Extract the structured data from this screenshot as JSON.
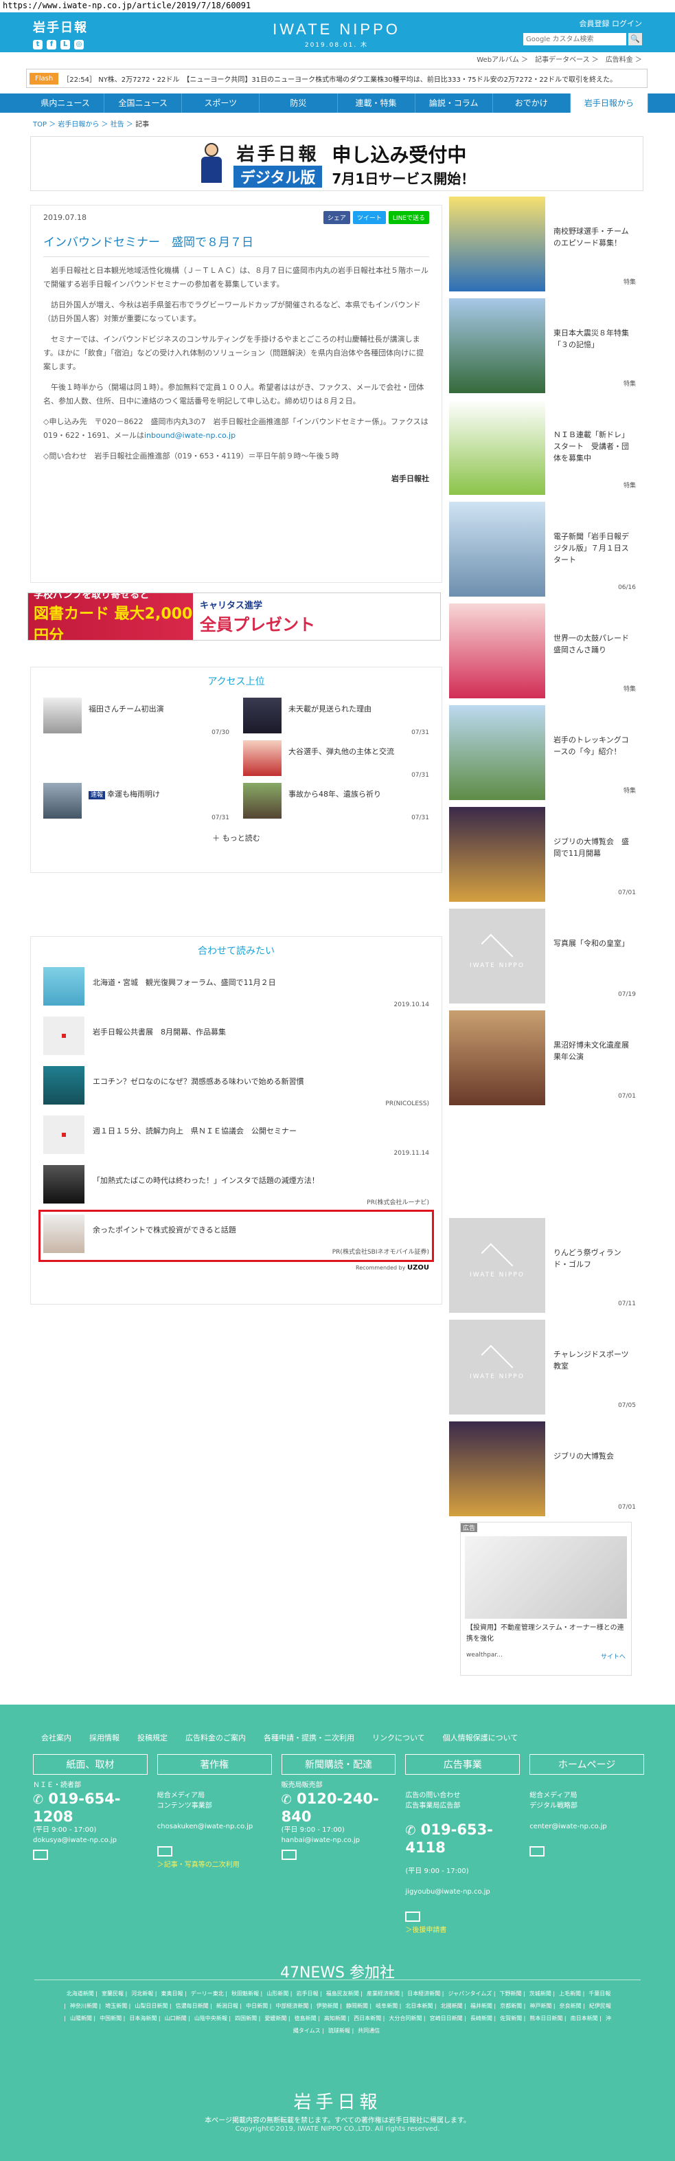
{
  "url": "https://www.iwate-np.co.jp/article/2019/7/18/60091",
  "header": {
    "logo": "岩手日報",
    "social": [
      "t",
      "f",
      "LINE",
      "ig"
    ],
    "brand": "IWATE NIPPO",
    "date": "2019.08.01. 木",
    "links": "会員登録 ログイン",
    "search_placeholder": "Google カスタム検索",
    "search_btn": "🔍"
  },
  "sublinks": [
    "Webアルバム ＞",
    "記事データベース ＞",
    "広告料金 ＞"
  ],
  "flash": {
    "label": "Flash",
    "text": "［22:54］ NY株、2万7272・22ドル　【ニューヨーク共同】31日のニューヨーク株式市場のダウ工業株30種平均は、前日比333・75ドル安の2万7272・22ドルで取引を終えた。"
  },
  "nav": [
    "県内ニュース",
    "全国ニュース",
    "スポーツ",
    "防災",
    "連載・特集",
    "論説・コラム",
    "おでかけ",
    "岩手日報から"
  ],
  "breadcrumb": [
    "TOP",
    "岩手日報から",
    "社告",
    "記事"
  ],
  "banner": {
    "logo1": "岩手日報",
    "logo2": "デジタル版",
    "copy1": "申し込み受付中",
    "copy2": "7月1日サービス開始！"
  },
  "article": {
    "date": "2019.07.18",
    "share": [
      "シェア",
      "ツイート",
      "LINEで送る"
    ],
    "title": "インバウンドセミナー　盛岡で８月７日",
    "p1": "岩手日報社と日本観光地域活性化機構（Ｊ－ＴＬＡＣ）は、８月７日に盛岡市内丸の岩手日報社本社５階ホールで開催する岩手日報インバウンドセミナーの参加者を募集しています。",
    "p2": "訪日外国人が増え、今秋は岩手県釜石市でラグビーワールドカップが開催されるなど、本県でもインバウンド（訪日外国人客）対策が重要になっています。",
    "p3": "セミナーでは、インバウンドビジネスのコンサルティングを手掛けるやまとごころの村山慶輔社長が講演します。ほかに「飲食」「宿泊」などの受け入れ体制のソリューション（問題解決）を県内自治体や各種団体向けに提案します。",
    "p4": "午後１時半から（開場は同１時）。参加無料で定員１００人。希望者ははがき、ファクス、メールで会社・団体名、参加人数、住所、日中に連絡のつく電話番号を明記して申し込む。締め切りは８月２日。",
    "apply": "◇申し込み先　〒020－8622　盛岡市内丸3の7　岩手日報社企画推進部「インバウンドセミナー係」。ファクスは019・622・1691、メールは",
    "apply_mail": "inbound@iwate-np.co.jp",
    "inquiry": "◇問い合わせ　岩手日報社企画推進部（019・653・4119）＝平日午前９時～午後５時",
    "source": "岩手日報社"
  },
  "adbar": {
    "line1": "学校パンフを取り寄せると",
    "line2": "図書カード 最大2,000円分",
    "line3": "キャリタス進学",
    "line4": "全員プレゼント"
  },
  "ranking": {
    "title": "アクセス上位",
    "items": [
      {
        "text": "福田さんチーム初出演",
        "date": "07/30"
      },
      {
        "text": "未天載が見送られた理由",
        "date": "07/31"
      },
      {
        "text": "",
        "date": ""
      },
      {
        "text": "大谷選手、弾丸他の主体と交流",
        "date": "07/31"
      },
      {
        "badge": "速報",
        "text": "幸運も梅雨明け",
        "date": "07/31"
      },
      {
        "text": "事故から48年、遺族ら祈り",
        "date": "07/31"
      }
    ],
    "more": "もっと読む"
  },
  "related": {
    "title": "合わせて読みたい",
    "items": [
      {
        "text": "北海道・宮城　観光復興フォーラム、盛岡で11月２日",
        "meta": "2019.10.14"
      },
      {
        "text": "岩手日報公共書展　8月開幕、作品募集",
        "meta": ""
      },
      {
        "text": "エコチン？ゼロなのになぜ？潤感感ある味わいで始める新習慣",
        "meta": "PR(NICOLESS)"
      },
      {
        "text": "週１日１５分、読解力向上　県ＮＩＥ協議会　公開セミナー",
        "meta": "2019.11.14"
      },
      {
        "text": "「加熱式たばこの時代は終わった！」インスタで話題の減煙方法！",
        "meta": "PR(株式会社ルーナビ)"
      },
      {
        "text": "余ったポイントで株式投資ができると話題",
        "meta": "PR(株式会社SBIネオモバイル証券)"
      }
    ],
    "recommend": "Recommended by",
    "recommend_brand": "UZOU"
  },
  "sidebar": [
    {
      "text": "南校野球選手・チームのエピソード募集！",
      "date": "特集"
    },
    {
      "text": "東日本大震災８年特集「３の記憶」",
      "date": "特集"
    },
    {
      "text": "ＮＩＢ連載「新ドレ」スタート　受講者・団体を募集中",
      "date": "特集"
    },
    {
      "text": "電子新聞「岩手日報デジタル版」７月１日スタート",
      "date": "06/16"
    },
    {
      "text": "世界一の太鼓パレード　盛岡さんさ踊り",
      "date": "特集"
    },
    {
      "text": "岩手のトレッキングコースの「今」紹介！",
      "date": "特集"
    },
    {
      "text": "ジブリの大博覧会　盛岡で11月開幕",
      "date": "07/01"
    },
    {
      "text": "写真展「令和の皇室」",
      "date": "07/19"
    },
    {
      "text": "黒沼好博未文化遺産展果年公演",
      "date": "07/01"
    },
    {
      "text": "りんどう祭ヴィランド・ゴルフ",
      "date": "07/11"
    },
    {
      "text": "チャレンジドスポーツ教室",
      "date": "07/05"
    },
    {
      "text": "ジブリの大博覧会",
      "date": "07/01"
    }
  ],
  "side_ad": {
    "pr": "広告",
    "text": "【投資用】不動産管理システム・オーナー様との連携を強化",
    "brand": "wealthpar...",
    "site": "サイトへ"
  },
  "footer": {
    "links": [
      "会社案内",
      "採用情報",
      "投稿規定",
      "広告料金のご案内",
      "各種申請・提携・二次利用",
      "リンクについて",
      "個人情報保護について"
    ],
    "cols": [
      {
        "title": "紙面、取材",
        "l1": "ＮＩＥ・読者部",
        "tel": "019-654-1208",
        "hours": "(平日 9:00 - 17:00)",
        "mail": "dokusya@iwate-np.co.jp",
        "extra": ""
      },
      {
        "title": "著作権",
        "l1": "総合メディア局\nコンテンツ事業部",
        "tel": "",
        "hours": "",
        "mail": "chosakuken@iwate-np.co.jp",
        "extra": "＞記事・写真等の二次利用"
      },
      {
        "title": "新聞購読・配達",
        "l1": "販売局販売部",
        "tel": "0120-240-840",
        "hours": "(平日 9:00 - 17:00)",
        "mail": "hanbai@iwate-np.co.jp",
        "extra": ""
      },
      {
        "title": "広告事業",
        "l1": "広告の問い合わせ\n広告事業局広告部",
        "tel": "019-653-4118",
        "hours": "(平日 9:00 - 17:00)",
        "mail": "jigyoubu@iwate-np.co.jp",
        "extra": "＞後援申請書"
      },
      {
        "title": "ホームページ",
        "l1": "総合メディア局\nデジタル戦略部",
        "tel": "",
        "hours": "",
        "mail": "center@iwate-np.co.jp",
        "extra": ""
      }
    ],
    "news47": "47NEWS 参加社",
    "papers": [
      "北海道新聞",
      "室蘭民報",
      "河北新報",
      "東奥日報",
      "デーリー東北",
      "秋田魁新報",
      "山形新聞",
      "岩手日報",
      "福島民友新聞",
      "産業経済新聞",
      "日本経済新聞",
      "ジャパンタイムズ",
      "下野新聞",
      "茨城新聞",
      "上毛新聞",
      "千葉日報",
      "神奈川新聞",
      "埼玉新聞",
      "山梨日日新聞",
      "信濃毎日新聞",
      "新潟日報",
      "中日新聞",
      "中部経済新聞",
      "伊勢新聞",
      "静岡新聞",
      "岐阜新聞",
      "北日本新聞",
      "北國新聞",
      "福井新聞",
      "京都新聞",
      "神戸新聞",
      "奈良新聞",
      "紀伊民報",
      "山陽新聞",
      "中国新聞",
      "日本海新聞",
      "山口新聞",
      "山陰中央新報",
      "四国新聞",
      "愛媛新聞",
      "徳島新聞",
      "高知新聞",
      "西日本新聞",
      "大分合同新聞",
      "宮崎日日新聞",
      "長崎新聞",
      "佐賀新聞",
      "熊本日日新聞",
      "南日本新聞",
      "沖縄タイムス",
      "琉球新報",
      "共同通信"
    ],
    "logo": "岩手日報",
    "copy1": "本ページ掲載内容の無断転載を禁じます。すべての著作権は岩手日報社に帰属します。",
    "copy2": "Copyright©2019, IWATE NIPPO CO.,LTD. All rights reserved."
  }
}
